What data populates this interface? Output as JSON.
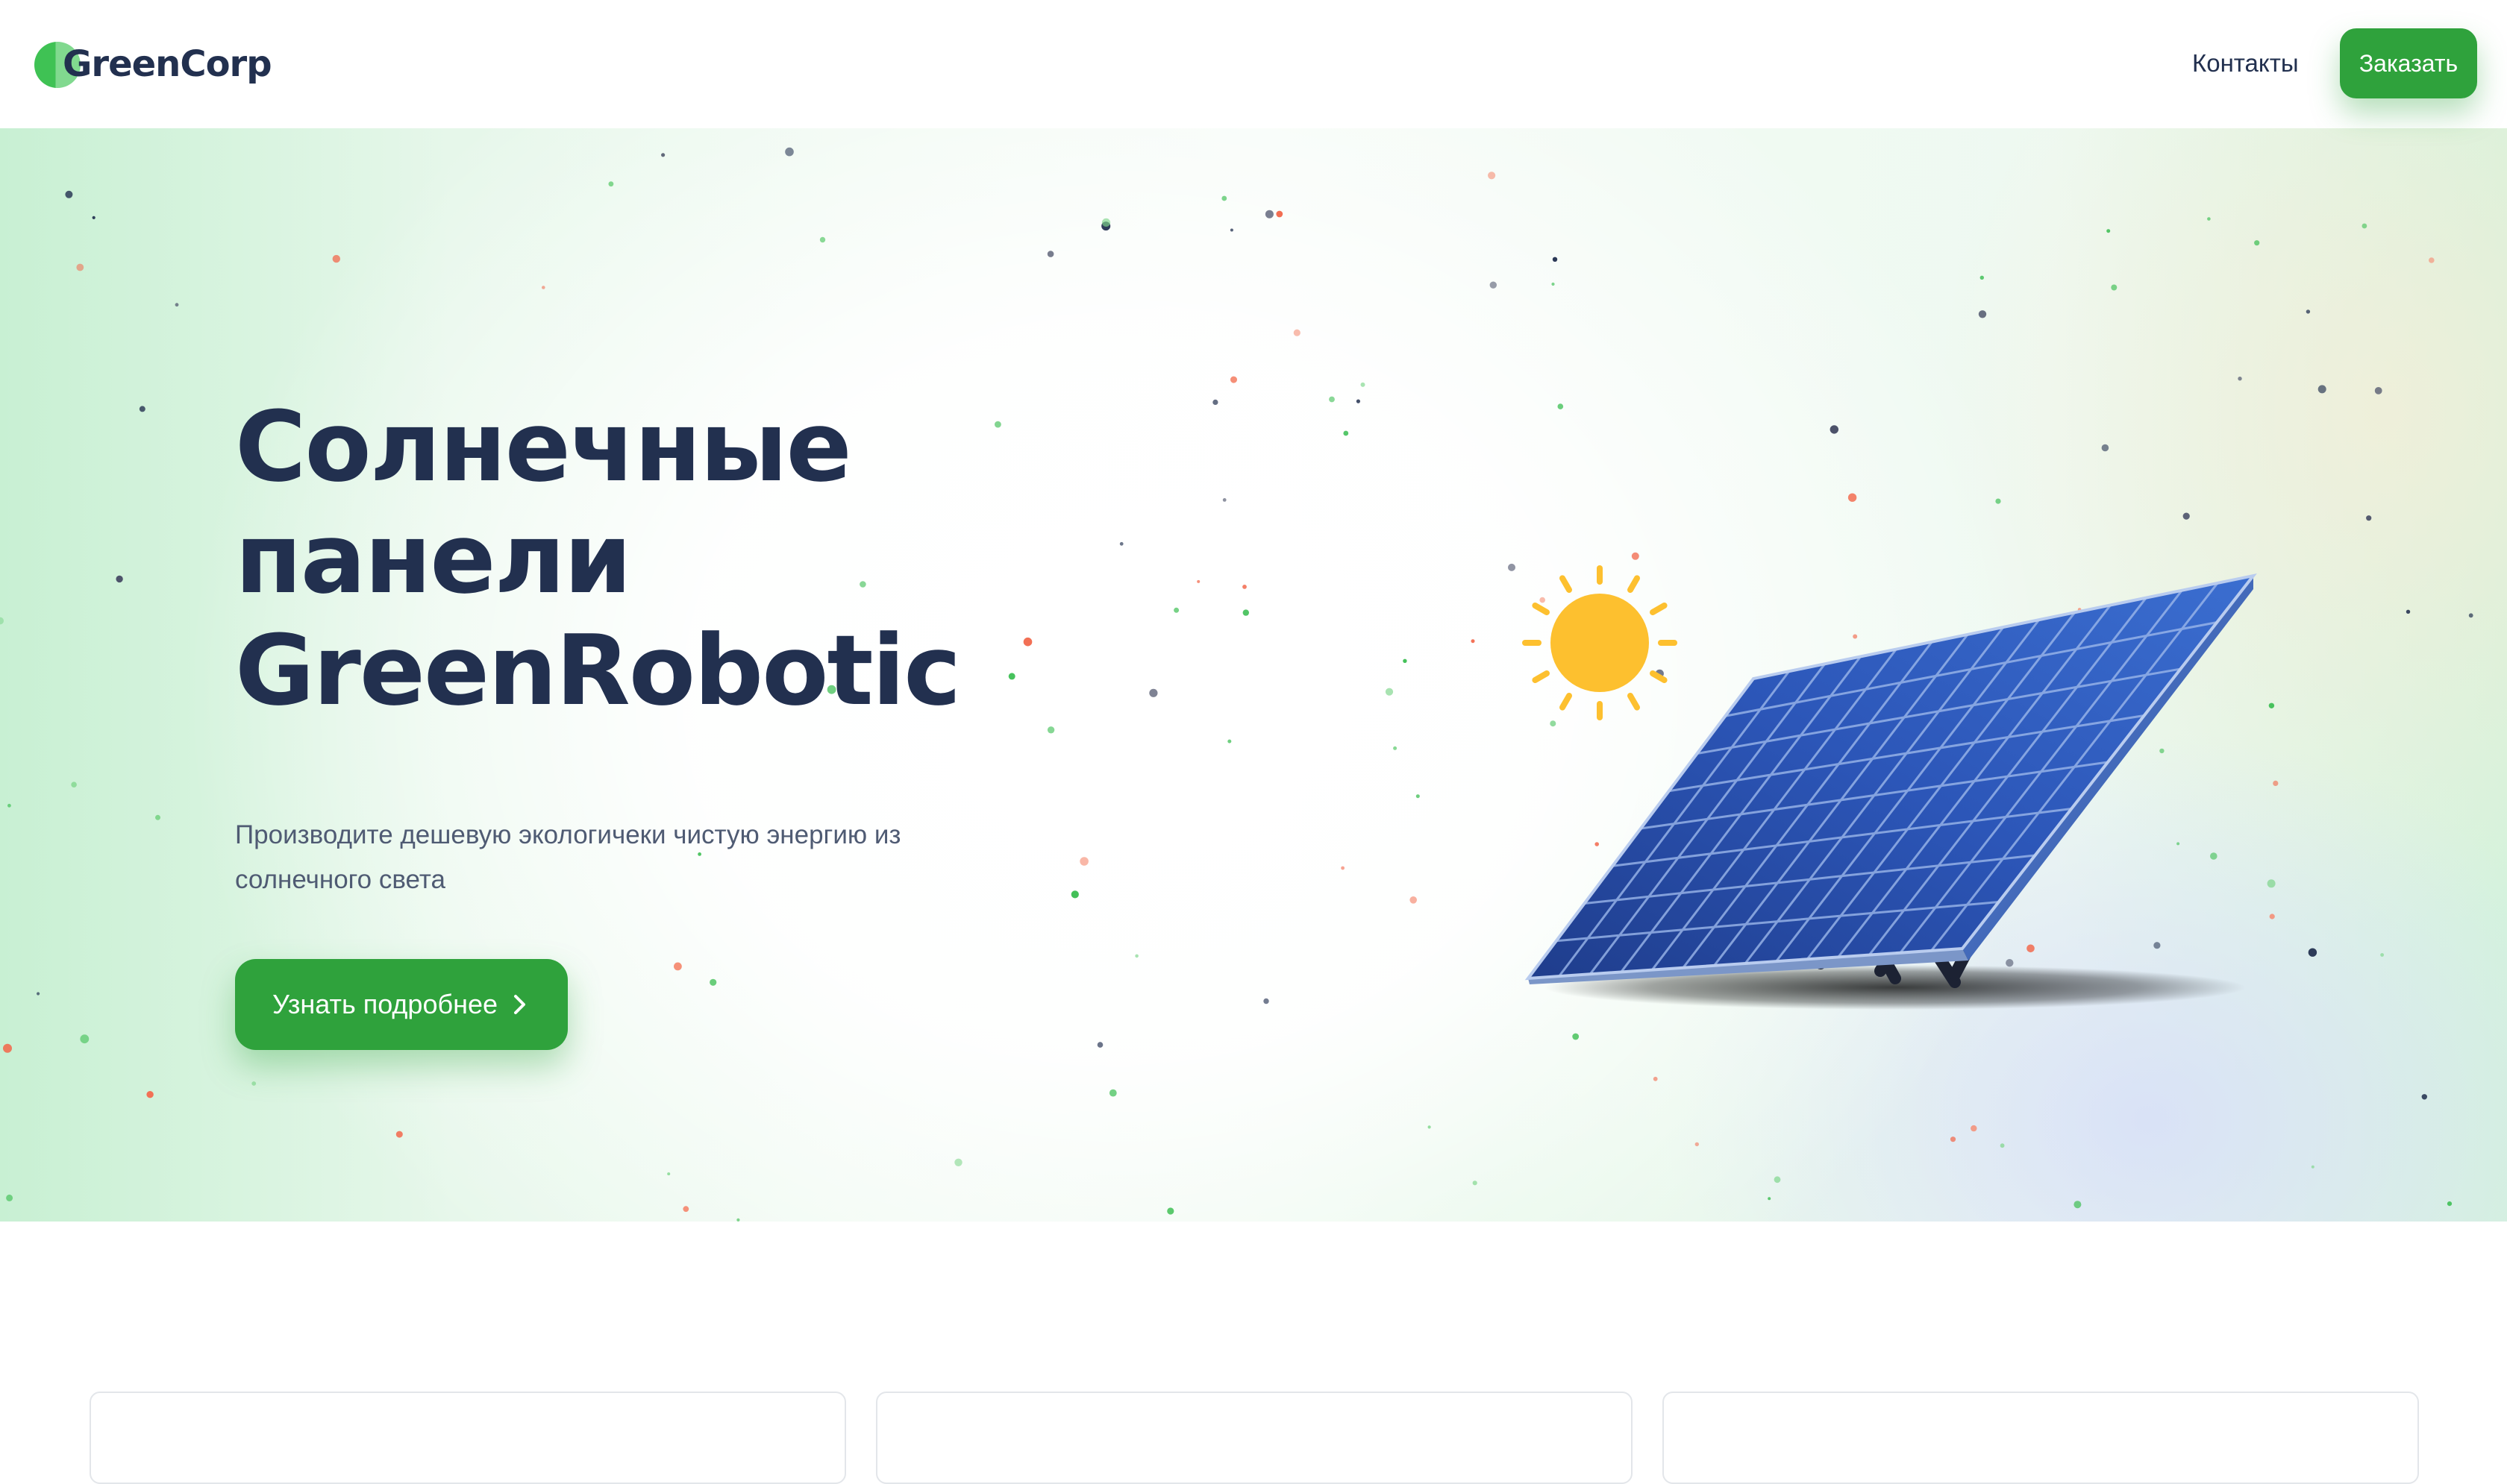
{
  "colors": {
    "accent": "#2fa23c",
    "heading": "#22304f",
    "body_text": "#4f5b73",
    "hero_bg": "#e6f7ea"
  },
  "header": {
    "logo_text": "GreenCorp",
    "nav_link": "Контакты",
    "cta_label": "Заказать"
  },
  "hero": {
    "title_lines": [
      "Солнечные",
      "панели",
      "GreenRobotic"
    ],
    "description": "Производите дешевую экологичеки чистую энергию из солнечного света",
    "button_label": "Узнать подробнее",
    "button_icon": "chevron-right-icon",
    "illustration": "sun-and-solar-panel"
  },
  "cards": [
    {},
    {},
    {}
  ]
}
